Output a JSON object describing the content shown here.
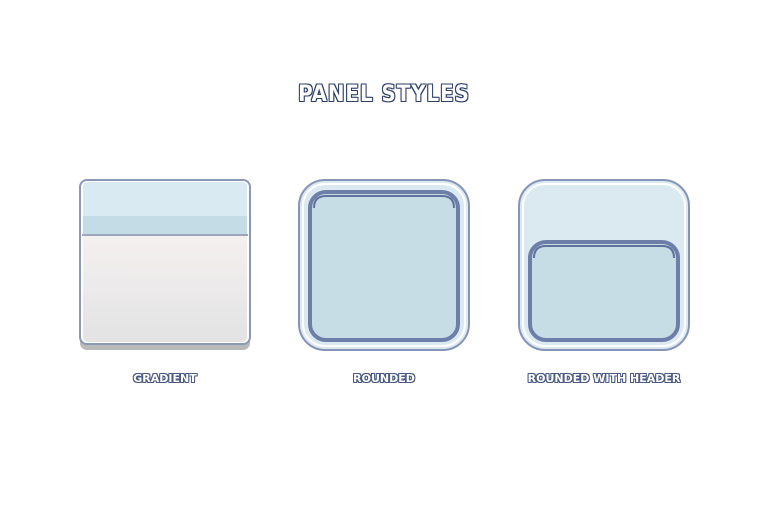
{
  "title": "Panel Styles",
  "panels": [
    {
      "caption": "Gradient",
      "icon": "gradient-panel-icon"
    },
    {
      "caption": "Rounded",
      "icon": "rounded-panel-icon"
    },
    {
      "caption": "Rounded with Header",
      "icon": "rounded-header-panel-icon"
    }
  ],
  "colors": {
    "outline": "#2e3e66",
    "panel_border": "#7f8fb3",
    "header_light": "#d9eaf2",
    "header_band": "#c4dce6",
    "body_light": "#f3f0f0",
    "body_dark": "#e4e4e4",
    "inner_fill": "#c6dde6",
    "inner_border": "#6d7fa8",
    "outer_fill": "#dbe9f1"
  }
}
